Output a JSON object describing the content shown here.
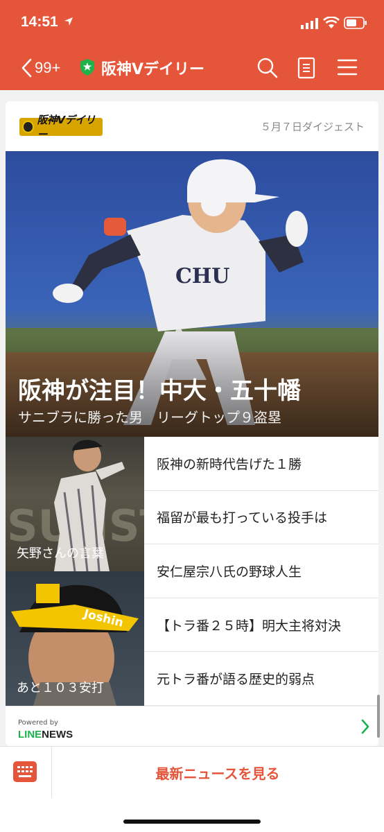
{
  "status_bar": {
    "time": "14:51"
  },
  "nav": {
    "back_count": "99+",
    "title": "阪神Vデイリー"
  },
  "digest": {
    "logo_text": "阪神Vデイリー",
    "date_label": "５月７日ダイジェスト"
  },
  "hero": {
    "title": "阪神が注目！中大・五十幡",
    "subtitle": "サニブラに勝った男　リーグトップ９盗塁"
  },
  "thumbnails": [
    {
      "caption": "矢野さんの言葉"
    },
    {
      "caption": "あと１０３安打"
    }
  ],
  "articles": [
    {
      "title": "阪神の新時代告げた１勝"
    },
    {
      "title": "福留が最も打っている投手は"
    },
    {
      "title": "安仁屋宗八氏の野球人生"
    },
    {
      "title": "【トラ番２５時】明大主将対決"
    },
    {
      "title": "元トラ番が語る歴史的弱点"
    }
  ],
  "footer": {
    "powered_by": "Powered by",
    "brand_line": "LINE",
    "brand_news": "NEWS"
  },
  "bottom_bar": {
    "latest_news_label": "最新ニュースを見る"
  },
  "colors": {
    "brand": "#e4553a",
    "line_green": "#19b24b"
  },
  "icons": [
    "location-arrow-icon",
    "signal-icon",
    "wifi-icon",
    "battery-icon",
    "back-chevron-icon",
    "official-shield-icon",
    "search-icon",
    "document-icon",
    "menu-icon",
    "chevron-right-icon",
    "keyboard-icon"
  ]
}
